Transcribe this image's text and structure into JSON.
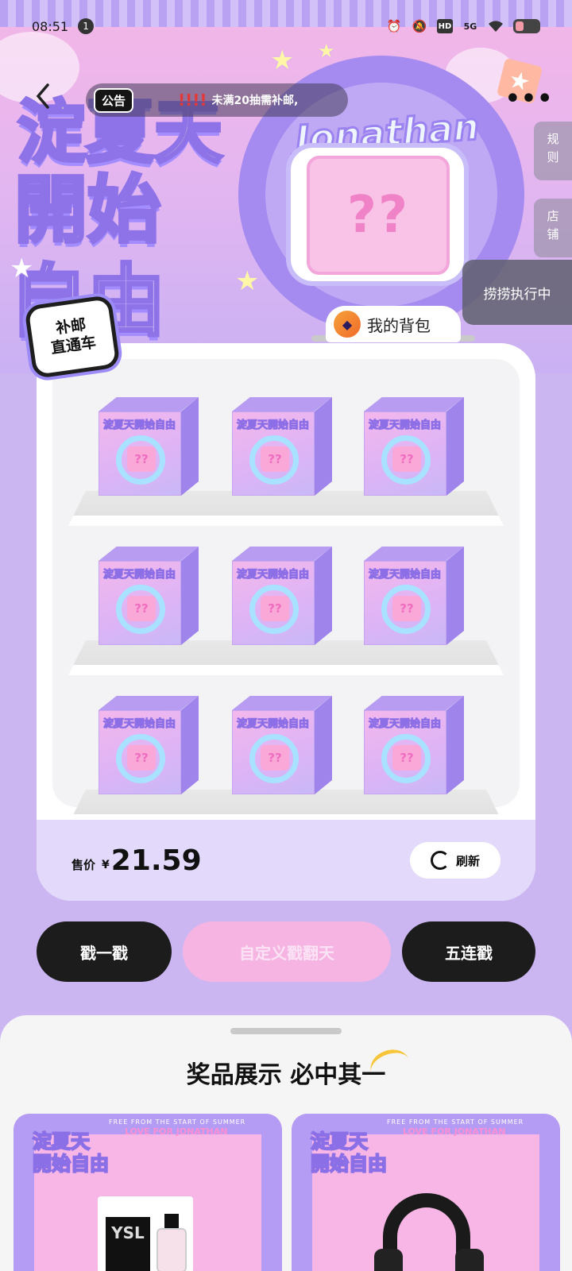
{
  "status_bar": {
    "time": "08:51",
    "notification_count": "1",
    "network_label": "5G",
    "hd_label": "HD"
  },
  "hero": {
    "title_line1": "淀夏天",
    "title_line2": "開始",
    "title_line3": "自由",
    "brand": "Jonathan",
    "screen_mark": "??"
  },
  "nav": {
    "notice_tag": "公告",
    "notice_marks": "!!!!",
    "notice_text": "未满20抽需补邮,",
    "more_label": "•••"
  },
  "side_tabs": {
    "rules": "规则",
    "store": "店铺",
    "running": "捞捞执行中"
  },
  "shelf": {
    "badge_line1": "补邮",
    "badge_line2": "直通车",
    "bag_label": "我的背包",
    "box_title": "淀夏天開始自由",
    "box_mark": "??",
    "box_count": 9,
    "price_label": "售价",
    "currency": "¥",
    "price": "21.59",
    "refresh_label": "刷新"
  },
  "actions": {
    "single": "戳一戳",
    "custom": "自定义戳翻天",
    "five": "五连戳"
  },
  "prizes": {
    "title": "奖品展示 必中其一",
    "items": [
      {
        "card_title_line1": "淀夏天",
        "card_title_line2": "開始自由",
        "band_small": "FREE FROM THE START OF SUMMER",
        "band_large": "LOVE FOR JONATHAN",
        "product": "perfume",
        "product_logo": "YSL"
      },
      {
        "card_title_line1": "淀夏天",
        "card_title_line2": "開始自由",
        "band_small": "FREE FROM THE START OF SUMMER",
        "band_large": "LOVE FOR JONATHAN",
        "product": "headphones"
      }
    ]
  },
  "colors": {
    "accent_pink": "#f6b4e3",
    "accent_purple": "#b49cf4",
    "dark_button": "#1c1c1c",
    "price_bar": "#e2d9fb"
  }
}
